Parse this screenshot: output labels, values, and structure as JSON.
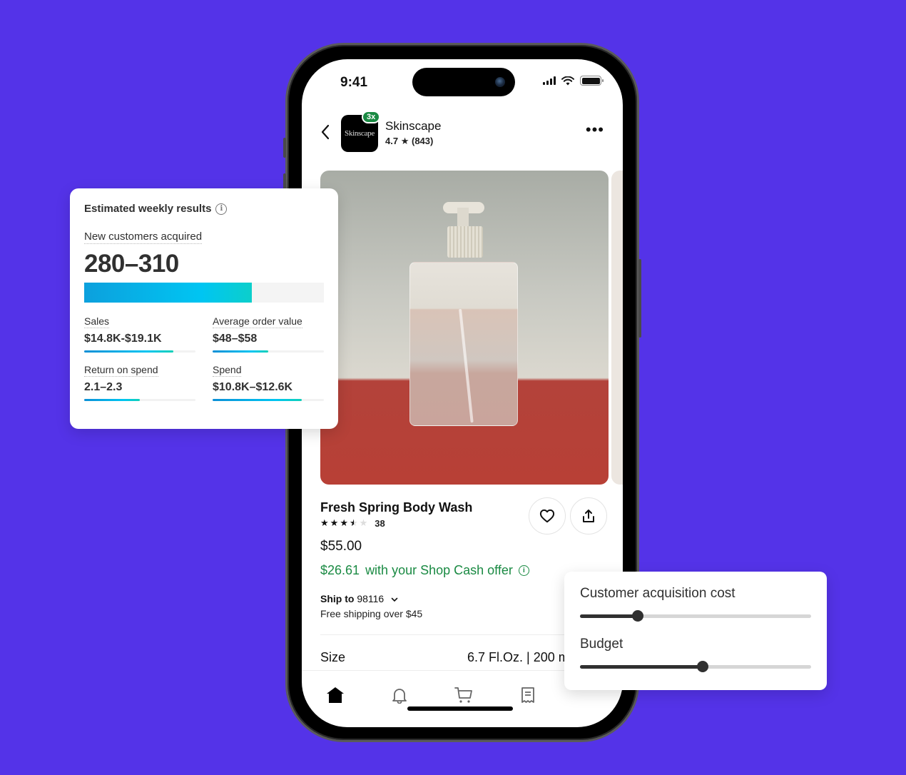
{
  "colors": {
    "background": "#5433E8",
    "shop_cash_green": "#1a8a43",
    "bar_gradient_start": "#0ca0dd",
    "bar_gradient_end": "#0ccfcb"
  },
  "phone": {
    "status_bar": {
      "time": "9:41",
      "icons": [
        "signal-icon",
        "wifi-icon",
        "battery-icon"
      ]
    },
    "store": {
      "logo_text": "Skinscape",
      "badge": "3x",
      "name": "Skinscape",
      "rating": "4.7",
      "review_count": "(843)",
      "back_icon": "chevron-left-icon",
      "more_icon": "more-horizontal-icon",
      "more_label": "•••"
    },
    "product": {
      "title": "Fresh Spring Body Wash",
      "rating_stars": 3.5,
      "rating_max": 5,
      "review_count": "38",
      "price": "$55.00",
      "shop_cash_price": "$26.61",
      "shop_cash_text": "with your Shop Cash offer",
      "ship_to_label": "Ship to",
      "ship_zip": "98116",
      "free_shipping": "Free shipping over $45",
      "size_label": "Size",
      "size_value": "6.7 Fl.Oz. | 200 ml"
    },
    "tabs": [
      {
        "name": "home",
        "icon": "home-icon",
        "active": true
      },
      {
        "name": "notifications",
        "icon": "bell-icon",
        "active": false
      },
      {
        "name": "cart",
        "icon": "cart-icon",
        "active": false
      },
      {
        "name": "orders",
        "icon": "receipt-icon",
        "active": false
      }
    ]
  },
  "results_card": {
    "title": "Estimated weekly results",
    "primary_label": "New customers acquired",
    "primary_value": "280–310",
    "primary_progress": 0.7,
    "metrics": [
      {
        "label": "Sales",
        "value": "$14.8K-$19.1K",
        "progress": 0.8
      },
      {
        "label": "Average order value",
        "value": "$48–$58",
        "progress": 0.5
      },
      {
        "label": "Return on spend",
        "value": "2.1–2.3",
        "progress": 0.5
      },
      {
        "label": "Spend",
        "value": "$10.8K–$12.6K",
        "progress": 0.8
      }
    ]
  },
  "slider_card": {
    "sliders": [
      {
        "label": "Customer acquisition cost",
        "value": 0.25
      },
      {
        "label": "Budget",
        "value": 0.53
      }
    ]
  }
}
